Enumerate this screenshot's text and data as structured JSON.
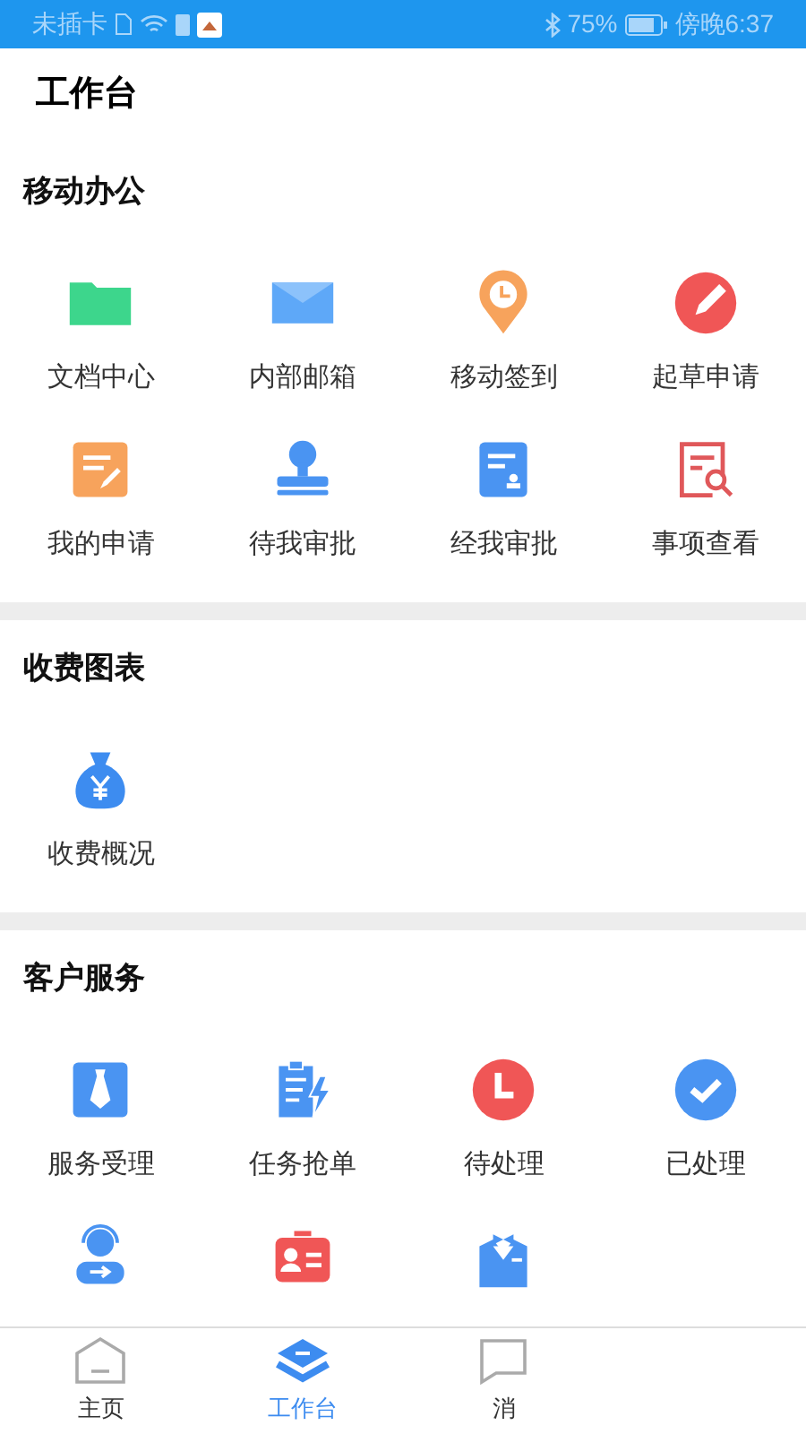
{
  "status_bar": {
    "carrier": "未插卡",
    "battery": "75%",
    "time": "傍晚6:37"
  },
  "header": {
    "title": "工作台"
  },
  "sections": [
    {
      "title": "移动办公",
      "items": [
        {
          "kind": "labeled",
          "label": "文档中心"
        },
        {
          "kind": "labeled",
          "label": "内部邮箱"
        },
        {
          "kind": "labeled",
          "label": "移动签到"
        },
        {
          "kind": "labeled",
          "label": "起草申请"
        },
        {
          "kind": "labeled",
          "label": "我的申请"
        },
        {
          "kind": "labeled",
          "label": "待我审批"
        },
        {
          "kind": "labeled",
          "label": "经我审批"
        },
        {
          "kind": "labeled",
          "label": "事项查看"
        }
      ]
    },
    {
      "title": "收费图表",
      "items": [
        {
          "kind": "labeled",
          "label": "收费概况"
        }
      ]
    },
    {
      "title": "客户服务",
      "items": [
        {
          "kind": "labeled",
          "label": "服务受理"
        },
        {
          "kind": "labeled",
          "label": "任务抢单"
        },
        {
          "kind": "labeled",
          "label": "待处理"
        },
        {
          "kind": "labeled",
          "label": "已处理"
        },
        {
          "kind": "icon-only"
        },
        {
          "kind": "icon-only"
        },
        {
          "kind": "icon-only"
        }
      ]
    }
  ],
  "tabs": [
    {
      "label": "主页",
      "selected": false
    },
    {
      "label": "工作台",
      "selected": true
    },
    {
      "label": "消",
      "selected": false
    }
  ]
}
